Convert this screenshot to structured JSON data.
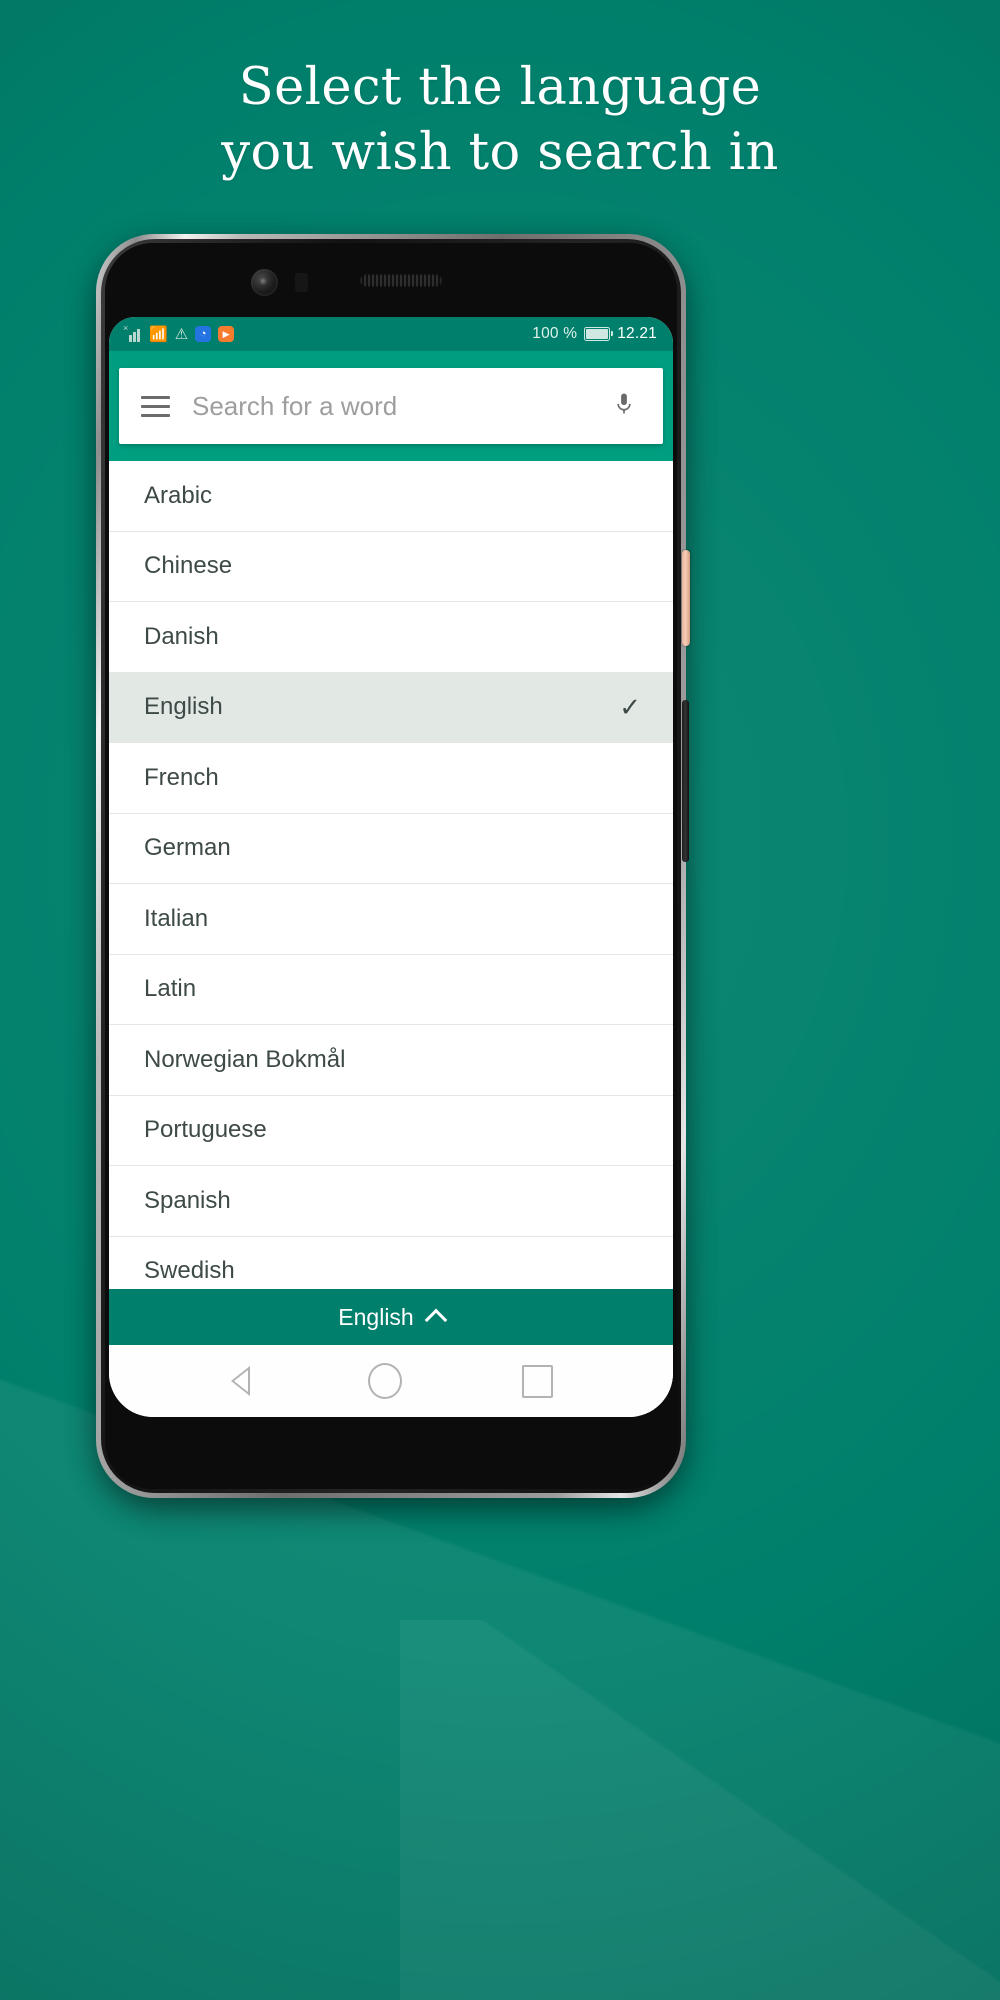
{
  "page": {
    "background_color": "#00806c",
    "headline_line1": "Select the language",
    "headline_line2": "you wish to search in"
  },
  "device": {
    "platform": "Android",
    "frame_color": "#8d8d8d",
    "power_button_color": "#e7b49c"
  },
  "status_bar": {
    "signal_icon": "signal-bars-no-sim-icon",
    "wifi_icon": "wifi-icon",
    "warning_icon": "warning-triangle-icon",
    "app_icon_blue": "blue-app-icon",
    "app_icon_blue_glyph": "◔",
    "app_icon_orange": "orange-play-icon",
    "app_icon_orange_glyph": "▶",
    "battery_percent": "100 %",
    "battery_icon": "battery-full-icon",
    "clock": "12.21",
    "background_color": "#00806c",
    "text_color": "#cfe8e1"
  },
  "toolbar": {
    "background_color": "#009e81",
    "menu_icon": "hamburger-menu-icon",
    "search_placeholder": "Search for a word",
    "search_value": "",
    "mic_icon": "microphone-icon"
  },
  "language_list": {
    "selected": "English",
    "check_icon": "checkmark-icon",
    "items": [
      {
        "label": "Arabic",
        "selected": false
      },
      {
        "label": "Chinese",
        "selected": false
      },
      {
        "label": "Danish",
        "selected": false
      },
      {
        "label": "English",
        "selected": true
      },
      {
        "label": "French",
        "selected": false
      },
      {
        "label": "German",
        "selected": false
      },
      {
        "label": "Italian",
        "selected": false
      },
      {
        "label": "Latin",
        "selected": false
      },
      {
        "label": "Norwegian Bokmål",
        "selected": false
      },
      {
        "label": "Portuguese",
        "selected": false
      },
      {
        "label": "Spanish",
        "selected": false
      },
      {
        "label": "Swedish",
        "selected": false
      }
    ]
  },
  "bottom_bar": {
    "label": "English",
    "chevron_icon": "chevron-up-icon",
    "background_color": "#00806c"
  },
  "nav_bar": {
    "back_icon": "back-triangle-icon",
    "home_icon": "home-circle-icon",
    "recents_icon": "recents-square-icon"
  }
}
